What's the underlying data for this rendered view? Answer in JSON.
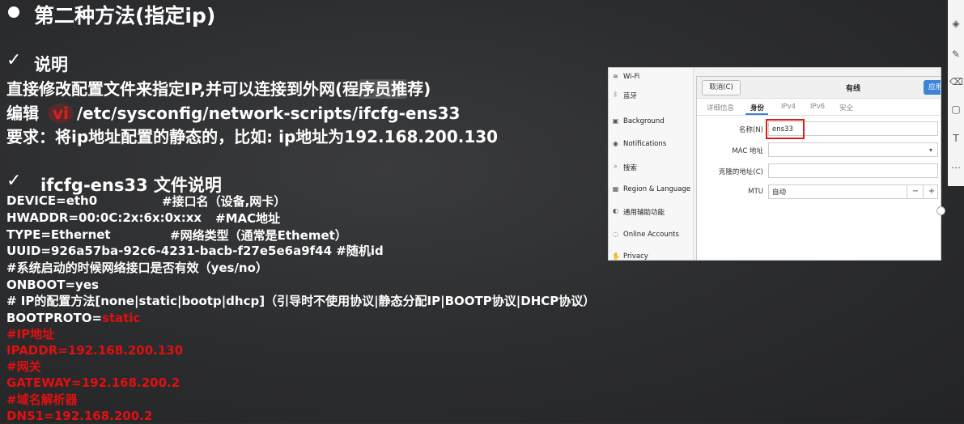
{
  "slide": {
    "title": "第二种方法(指定ip)",
    "section1": {
      "check": "✓",
      "heading": "说明",
      "line1_a": "直接修改配置文件来指定IP,并可以连接到外网(程",
      "line1_b": "序员推",
      "line1_c": "荐)",
      "line2_a": "编辑",
      "line2_vi": "vi",
      "line2_b": "/etc/sysconfig/network-scripts/ifcfg-ens33",
      "line3": "要求：将ip地址配置的静态的，比如: ip地址为192.168.200.130"
    },
    "section2": {
      "check": "✓",
      "heading": "ifcfg-ens33 文件说明",
      "device": "DEVICE=eth0",
      "device_cmt": "#接口名（设备,网卡）",
      "hwaddr": "HWADDR=00:0C:2x:6x:0x:xx",
      "hwaddr_cmt": "#MAC地址",
      "type": "TYPE=Ethernet",
      "type_cmt": "#网络类型（通常是Ethemet）",
      "uuid": "UUID=926a57ba-92c6-4231-bacb-f27e5e6a9f44  #随机id",
      "onboot_cmt": "#系统启动的时候网络接口是否有效（yes/no）",
      "onboot": "ONBOOT=yes",
      "proto_cmt": "# IP的配置方法[none|static|bootp|dhcp]（引导时不使用协议|静态分配IP|BOOTP协议|DHCP协议）",
      "bootproto_key": "BOOTPROTO=",
      "bootproto_val": "static",
      "ip_cmt": "#IP地址",
      "ipaddr": "IPADDR=192.168.200.130",
      "gw_cmt": "#网关",
      "gateway": "GATEWAY=192.168.200.2",
      "dns_cmt": "#域名解析器",
      "dns1": "DNS1=192.168.200.2"
    }
  },
  "screenshot": {
    "sidebar": [
      {
        "icon": "wifi-icon",
        "glyph": "≋",
        "label": "Wi-Fi"
      },
      {
        "icon": "bluetooth-icon",
        "glyph": "ᛒ",
        "label": "蓝牙"
      },
      {
        "icon": "background-icon",
        "glyph": "▣",
        "label": "Background"
      },
      {
        "icon": "notifications-icon",
        "glyph": "◉",
        "label": "Notifications"
      },
      {
        "icon": "search-icon",
        "glyph": "⌕",
        "label": "搜索"
      },
      {
        "icon": "region-icon",
        "glyph": "▦",
        "label": "Region & Language"
      },
      {
        "icon": "accessibility-icon",
        "glyph": "◐",
        "label": "通用辅助功能"
      },
      {
        "icon": "online-accounts-icon",
        "glyph": "◌",
        "label": "Online Accounts"
      },
      {
        "icon": "privacy-icon",
        "glyph": "✋",
        "label": "Privacy"
      }
    ],
    "dialog": {
      "cancel": "取消(C)",
      "title": "有线",
      "apply": "应用(",
      "tabs": [
        "详细信息",
        "身份",
        "IPv4",
        "IPv6",
        "安全"
      ],
      "name_label": "名称(N)",
      "name_value": "ens33",
      "mac_label": "MAC 地址",
      "clone_label": "克隆的地址(C)",
      "mtu_label": "MTU",
      "mtu_value": "自动",
      "mtu_minus": "−",
      "mtu_plus": "+"
    }
  },
  "toolbar": [
    "layers-icon",
    "pen-icon",
    "eraser-icon",
    "shape-icon",
    "text-icon",
    "more-icon"
  ]
}
